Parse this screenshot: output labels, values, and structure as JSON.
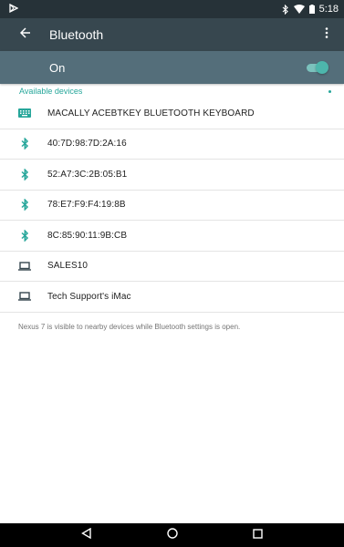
{
  "status_bar": {
    "time": "5:18",
    "icons": [
      "play-store-notification-icon",
      "bluetooth-icon",
      "wifi-icon",
      "battery-icon"
    ]
  },
  "app_bar": {
    "title": "Bluetooth",
    "back_icon": "arrow-back-icon",
    "overflow_icon": "more-vert-icon"
  },
  "toggle": {
    "label": "On",
    "state": "on",
    "accent_color": "#4db6ac"
  },
  "section": {
    "title": "Available devices"
  },
  "devices": [
    {
      "name": "MACALLY ACEBTKEY BLUETOOTH KEYBOARD",
      "icon": "keyboard-icon"
    },
    {
      "name": "40:7D:98:7D:2A:16",
      "icon": "bluetooth-icon"
    },
    {
      "name": "52:A7:3C:2B:05:B1",
      "icon": "bluetooth-icon"
    },
    {
      "name": "78:E7:F9:F4:19:8B",
      "icon": "bluetooth-icon"
    },
    {
      "name": "8C:85:90:11:9B:CB",
      "icon": "bluetooth-icon"
    },
    {
      "name": "SALES10",
      "icon": "laptop-icon"
    },
    {
      "name": "Tech Support's iMac",
      "icon": "laptop-icon"
    }
  ],
  "footer": {
    "note": "Nexus 7 is visible to nearby devices while Bluetooth settings is open."
  },
  "nav_bar": {
    "buttons": [
      "back-triangle-icon",
      "home-circle-icon",
      "recents-square-icon"
    ]
  },
  "colors": {
    "status_bar": "#263238",
    "app_bar": "#37474f",
    "toggle_bar": "#546e7a",
    "accent": "#26a69a"
  }
}
